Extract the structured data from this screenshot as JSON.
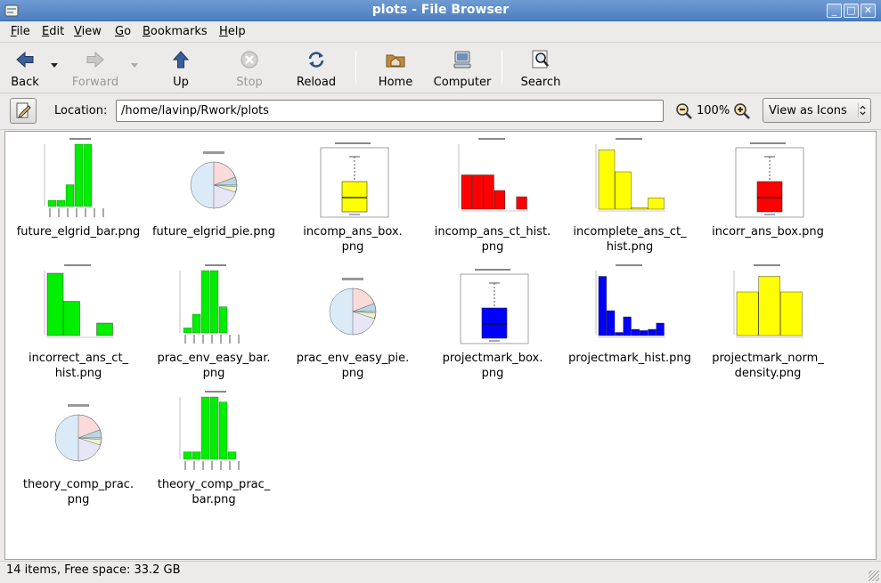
{
  "window": {
    "title": "plots - File Browser"
  },
  "menu": [
    {
      "label": "File",
      "mnemonic": "F",
      "rest": "ile"
    },
    {
      "label": "Edit",
      "mnemonic": "E",
      "rest": "dit"
    },
    {
      "label": "View",
      "mnemonic": "V",
      "rest": "iew"
    },
    {
      "label": "Go",
      "mnemonic": "G",
      "rest": "o"
    },
    {
      "label": "Bookmarks",
      "mnemonic": "B",
      "rest": "ookmarks"
    },
    {
      "label": "Help",
      "mnemonic": "H",
      "rest": "elp"
    }
  ],
  "toolbar": {
    "back": "Back",
    "forward": "Forward",
    "up": "Up",
    "stop": "Stop",
    "reload": "Reload",
    "home": "Home",
    "computer": "Computer",
    "search": "Search"
  },
  "location": {
    "label": "Location:",
    "path": "/home/lavinp/Rwork/plots",
    "zoom": "100%",
    "view_mode": "View as Icons"
  },
  "files": [
    {
      "name": "future_elgrid_bar.png",
      "kind": "bar",
      "color": "#00ee00"
    },
    {
      "name": "future_elgrid_pie.png",
      "kind": "pie"
    },
    {
      "name": "incomp_ans_box.\npng",
      "kind": "box",
      "color": "#ffff00"
    },
    {
      "name": "incomp_ans_ct_hist.\npng",
      "kind": "hist",
      "color": "#ff0000"
    },
    {
      "name": "incomplete_ans_ct_\nhist.png",
      "kind": "hist",
      "color": "#ffff00"
    },
    {
      "name": "incorr_ans_box.png",
      "kind": "box",
      "color": "#ff0000"
    },
    {
      "name": "incorrect_ans_ct_\nhist.png",
      "kind": "hist",
      "color": "#00ee00"
    },
    {
      "name": "prac_env_easy_bar.\npng",
      "kind": "bar",
      "color": "#00ee00"
    },
    {
      "name": "prac_env_easy_pie.\npng",
      "kind": "pie"
    },
    {
      "name": "projectmark_box.\npng",
      "kind": "box",
      "color": "#0000ff"
    },
    {
      "name": "projectmark_hist.png",
      "kind": "hist",
      "color": "#0000ff"
    },
    {
      "name": "projectmark_norm_\ndensity.png",
      "kind": "hist",
      "color": "#ffff00"
    },
    {
      "name": "theory_comp_prac.\npng",
      "kind": "pie"
    },
    {
      "name": "theory_comp_prac_\nbar.png",
      "kind": "bar",
      "color": "#00ee00"
    }
  ],
  "status": {
    "text": "14 items, Free space: 33.2 GB"
  }
}
